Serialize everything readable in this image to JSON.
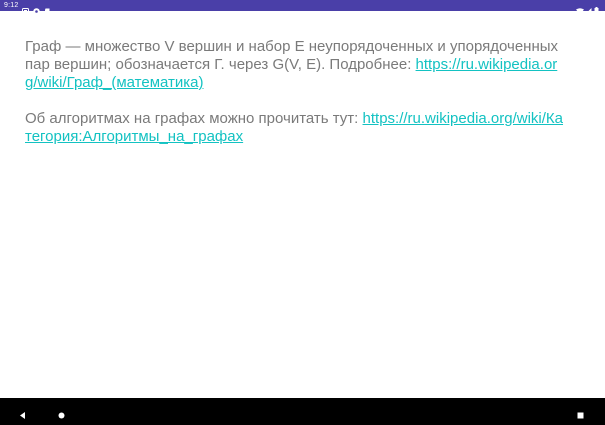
{
  "status_bar": {
    "time": "9:12",
    "icons_left": [
      "notification-icon",
      "chrome-icon",
      "sd-card-icon"
    ],
    "icons_right": [
      "wifi-icon",
      "signal-icon",
      "battery-icon"
    ],
    "background_color": "#4a3fa8"
  },
  "content": {
    "paragraph1": {
      "text": "Граф — множество V вершин и набор E неупорядоченных и упорядоченных пар вершин; обозначается Г. через G(V, E). Подробнее: ",
      "link": "https://ru.wikipedia.org/wiki/Граф_(математика)"
    },
    "paragraph2": {
      "text": "Об алгоритмах на графах можно прочитать тут: ",
      "link": "https://ru.wikipedia.org/wiki/Категория:Алгоритмы_на_графах"
    },
    "text_color": "#7a7a7a",
    "link_color": "#13c2c2"
  },
  "nav_bar": {
    "buttons": [
      "back-icon",
      "home-icon",
      "recents-icon"
    ]
  }
}
